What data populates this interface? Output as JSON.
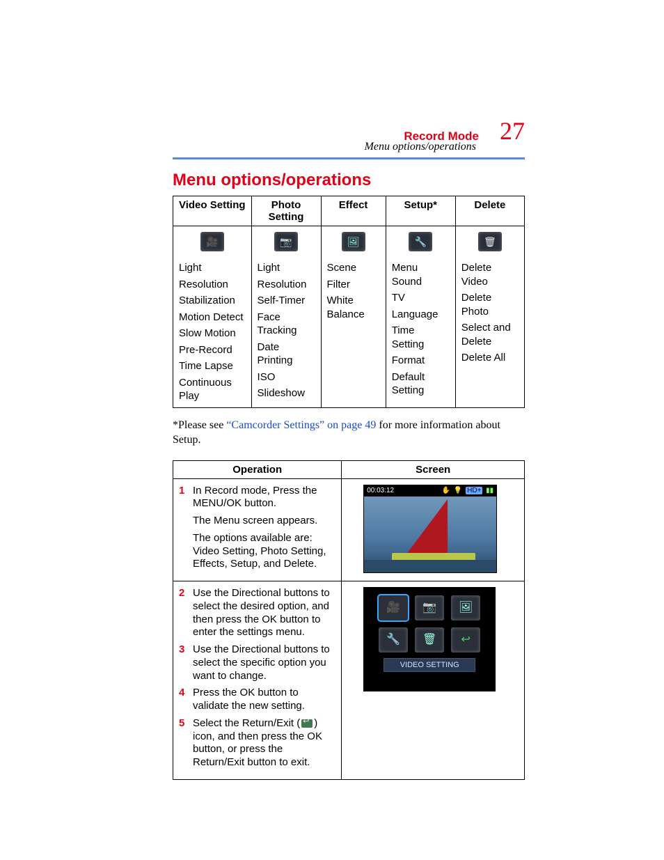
{
  "header": {
    "section": "Record Mode",
    "breadcrumb": "Menu options/operations",
    "page_number": "27"
  },
  "title": "Menu options/operations",
  "menu_table": {
    "columns": [
      "Video Setting",
      "Photo Setting",
      "Effect",
      "Setup*",
      "Delete"
    ],
    "rows": {
      "video": [
        "Light",
        "Resolution",
        "Stabilization",
        "Motion Detect",
        "Slow Motion",
        "Pre-Record",
        "Time Lapse",
        "Continuous Play"
      ],
      "photo": [
        "Light",
        "Resolution",
        "Self-Timer",
        "Face Tracking",
        "Date Printing",
        "ISO",
        "Slideshow"
      ],
      "effect": [
        "Scene",
        "Filter",
        "White Balance"
      ],
      "setup": [
        "Menu Sound",
        "TV",
        "Language",
        "Time Setting",
        "Format",
        "Default Setting"
      ],
      "delete": [
        "Delete Video",
        "Delete Photo",
        "Select and Delete",
        "Delete All"
      ]
    }
  },
  "footnote": {
    "prefix": "*Please see ",
    "link": "“Camcorder Settings” on page 49",
    "suffix": " for more information about Setup."
  },
  "ops_table": {
    "headers": [
      "Operation",
      "Screen"
    ],
    "row1": {
      "num": "1",
      "text1": "In Record mode, Press the MENU/OK button.",
      "text2": "The Menu screen appears.",
      "text3": "The options available are: Video Setting, Photo Setting, Effects, Setup, and Delete."
    },
    "row2": {
      "steps": [
        {
          "num": "2",
          "text": "Use the Directional buttons to select the desired option, and then press the OK button to enter the settings menu."
        },
        {
          "num": "3",
          "text": "Use the Directional buttons to select the specific option you want to change."
        },
        {
          "num": "4",
          "text": "Press the OK button to validate the new setting."
        },
        {
          "num": "5",
          "text_before": "Select the Return/Exit (",
          "text_after": ") icon, and then press the OK button, or press the Return/Exit button to exit."
        }
      ]
    }
  },
  "screen1": {
    "time": "00:03:12",
    "hd": "HD+"
  },
  "screen2": {
    "caption": "VIDEO SETTING"
  }
}
